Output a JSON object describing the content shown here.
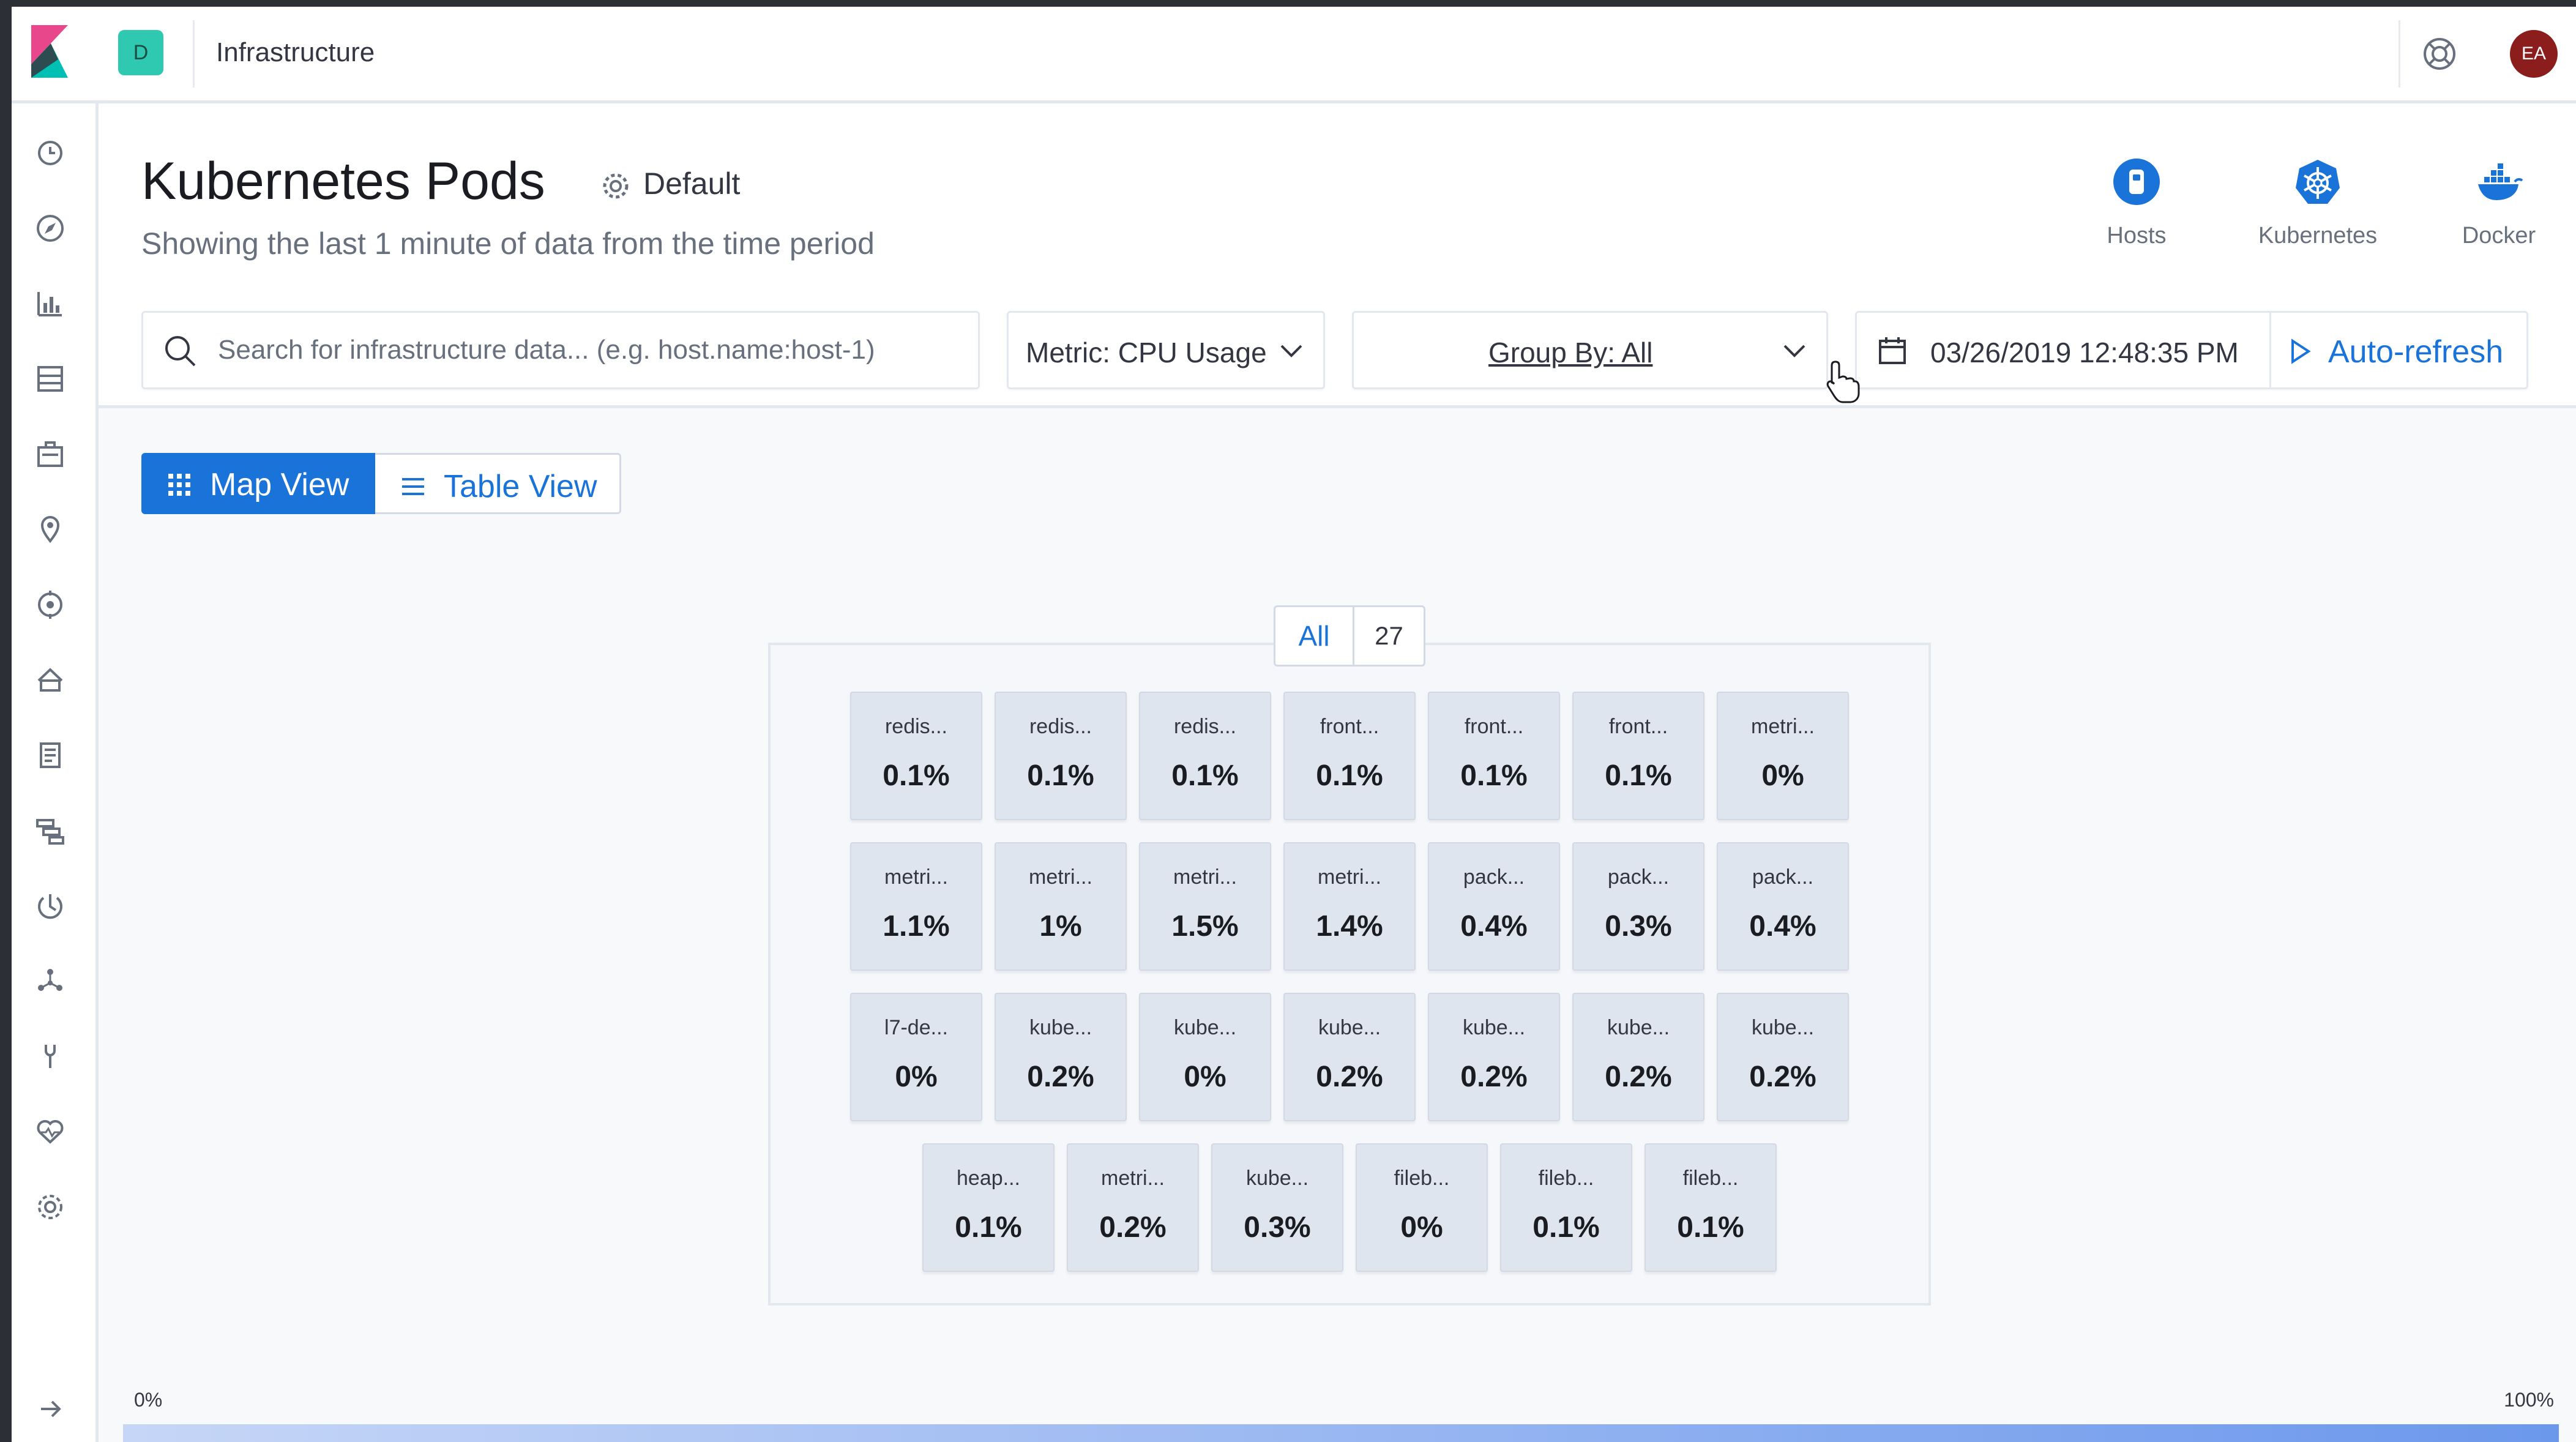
{
  "topbar": {
    "space_initial": "D",
    "app_title": "Infrastructure",
    "user_initials": "EA"
  },
  "nav_icons": [
    "clock-icon",
    "compass-icon",
    "visualize-icon",
    "dashboard-icon",
    "canvas-icon",
    "maps-icon",
    "ml-icon",
    "infrastructure-icon",
    "logs-icon",
    "apm-icon",
    "uptime-icon",
    "graph-icon",
    "devtools-icon",
    "monitoring-icon",
    "management-icon",
    "collapse-arrow-icon"
  ],
  "header": {
    "title": "Kubernetes Pods",
    "saved_view": "Default",
    "subtitle": "Showing the last 1 minute of data from the time period"
  },
  "sources": [
    {
      "label": "Hosts",
      "icon": "hosts-icon"
    },
    {
      "label": "Kubernetes",
      "icon": "kubernetes-icon"
    },
    {
      "label": "Docker",
      "icon": "docker-icon"
    }
  ],
  "filters": {
    "search_placeholder": "Search for infrastructure data... (e.g. host.name:host-1)",
    "metric": "Metric: CPU Usage",
    "group_by": "Group By: All",
    "datetime": "03/26/2019 12:48:35 PM",
    "auto_refresh": "Auto-refresh"
  },
  "view_toggle": {
    "map": "Map View",
    "table": "Table View",
    "selected": "map"
  },
  "colors": {
    "accent": "#1a73d9",
    "node_fill": "#dfe5ef",
    "legend_start": "#c6d6f7",
    "legend_end": "#6c98ec"
  },
  "map": {
    "group_label": "All",
    "group_count": "27",
    "nodes": [
      {
        "name": "redis...",
        "value": "0.1%"
      },
      {
        "name": "redis...",
        "value": "0.1%"
      },
      {
        "name": "redis...",
        "value": "0.1%"
      },
      {
        "name": "front...",
        "value": "0.1%"
      },
      {
        "name": "front...",
        "value": "0.1%"
      },
      {
        "name": "front...",
        "value": "0.1%"
      },
      {
        "name": "metri...",
        "value": "0%"
      },
      {
        "name": "metri...",
        "value": "1.1%"
      },
      {
        "name": "metri...",
        "value": "1%"
      },
      {
        "name": "metri...",
        "value": "1.5%"
      },
      {
        "name": "metri...",
        "value": "1.4%"
      },
      {
        "name": "pack...",
        "value": "0.4%"
      },
      {
        "name": "pack...",
        "value": "0.3%"
      },
      {
        "name": "pack...",
        "value": "0.4%"
      },
      {
        "name": "l7-de...",
        "value": "0%"
      },
      {
        "name": "kube...",
        "value": "0.2%"
      },
      {
        "name": "kube...",
        "value": "0%"
      },
      {
        "name": "kube...",
        "value": "0.2%"
      },
      {
        "name": "kube...",
        "value": "0.2%"
      },
      {
        "name": "kube...",
        "value": "0.2%"
      },
      {
        "name": "kube...",
        "value": "0.2%"
      },
      {
        "name": "heap...",
        "value": "0.1%"
      },
      {
        "name": "metri...",
        "value": "0.2%"
      },
      {
        "name": "kube...",
        "value": "0.3%"
      },
      {
        "name": "fileb...",
        "value": "0%"
      },
      {
        "name": "fileb...",
        "value": "0.1%"
      },
      {
        "name": "fileb...",
        "value": "0.1%"
      }
    ]
  },
  "legend": {
    "min_label": "0%",
    "max_label": "100%"
  }
}
